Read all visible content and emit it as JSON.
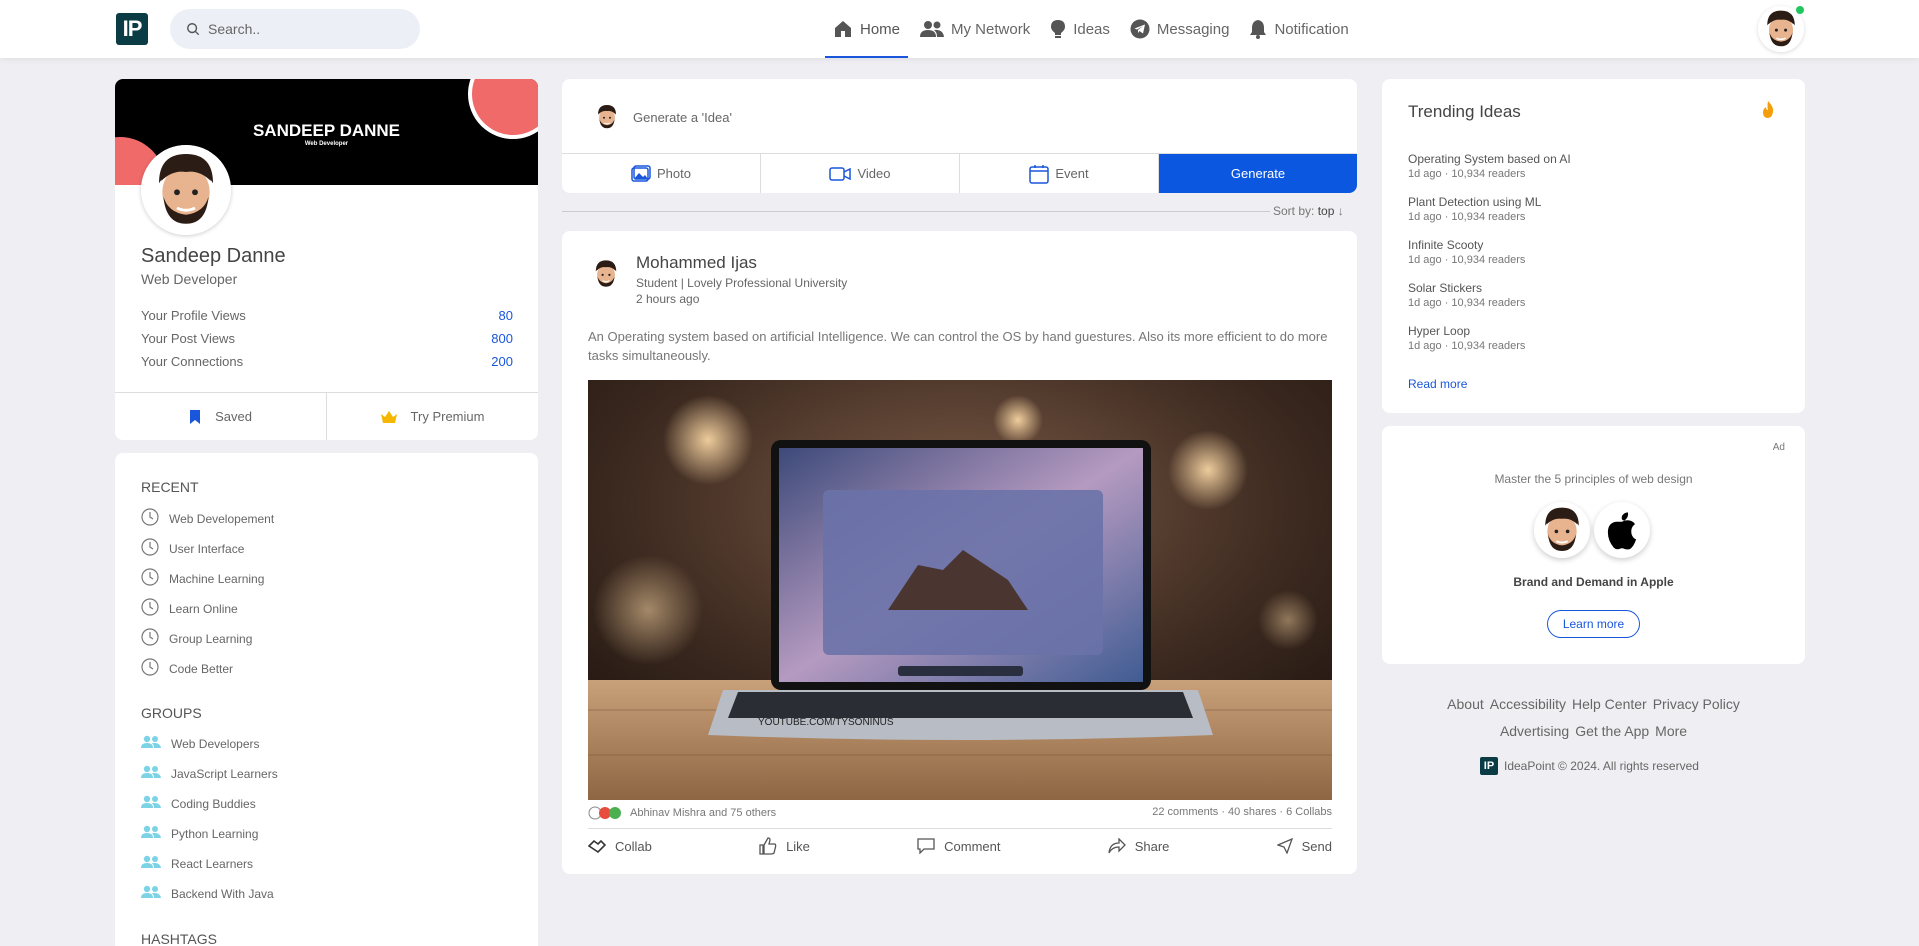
{
  "topbar": {
    "logo": "IP",
    "search_placeholder": "Search..",
    "nav": [
      {
        "label": "Home",
        "icon": "home-icon"
      },
      {
        "label": "My Network",
        "icon": "people-icon"
      },
      {
        "label": "Ideas",
        "icon": "bulb-icon"
      },
      {
        "label": "Messaging",
        "icon": "telegram-icon"
      },
      {
        "label": "Notification",
        "icon": "bell-icon"
      }
    ]
  },
  "profile": {
    "cover_title": "SANDEEP DANNE",
    "cover_subtitle": "Web Developer",
    "name": "Sandeep Danne",
    "role": "Web Developer",
    "stats": [
      {
        "label": "Your Profile Views",
        "value": "80"
      },
      {
        "label": "Your Post Views",
        "value": "800"
      },
      {
        "label": "Your Connections",
        "value": "200"
      }
    ],
    "saved_label": "Saved",
    "premium_label": "Try Premium"
  },
  "sidebar": {
    "recent_title": "RECENT",
    "recent": [
      "Web Developement",
      "User Interface",
      "Machine Learning",
      "Learn Online",
      "Group Learning",
      "Code Better"
    ],
    "groups_title": "GROUPS",
    "groups": [
      "Web Developers",
      "JavaScript Learners",
      "Coding Buddies",
      "Python Learning",
      "React Learners",
      "Backend With Java"
    ],
    "hashtags_title": "HASHTAGS"
  },
  "composer": {
    "prompt": "Generate a 'Idea'",
    "photo_label": "Photo",
    "video_label": "Video",
    "event_label": "Event",
    "generate_label": "Generate"
  },
  "sort": {
    "label": "Sort by:",
    "value": "top"
  },
  "post": {
    "author": "Mohammed Ijas",
    "subtitle": "Student | Lovely Professional University",
    "time": "2 hours ago",
    "text": "An Operating system based on artificial Intelligence. We can control the OS by hand guestures. Also its more efficient to do more tasks simultaneously.",
    "image_watermark": "YOUTUBE.COM/TYSONINUS",
    "reactions": "Abhinav Mishra and 75 others",
    "counts": "22 comments · 40 shares · 6 Collabs",
    "actions": [
      "Collab",
      "Like",
      "Comment",
      "Share",
      "Send"
    ]
  },
  "trending": {
    "title": "Trending Ideas",
    "items": [
      {
        "title": "Operating System based on AI",
        "meta": "1d ago · 10,934 readers"
      },
      {
        "title": "Plant Detection using ML",
        "meta": "1d ago · 10,934 readers"
      },
      {
        "title": "Infinite Scooty",
        "meta": "1d ago · 10,934 readers"
      },
      {
        "title": "Solar Stickers",
        "meta": "1d ago · 10,934 readers"
      },
      {
        "title": "Hyper Loop",
        "meta": "1d ago · 10,934 readers"
      }
    ],
    "read_more": "Read more"
  },
  "ad": {
    "tag": "Ad",
    "headline": "Master the 5 principles of web design",
    "title": "Brand and Demand in Apple",
    "button": "Learn more"
  },
  "footer": {
    "row1": [
      "About",
      "Accessibility",
      "Help Center",
      "Privacy Policy"
    ],
    "row2": [
      "Advertising",
      "Get the App",
      "More"
    ],
    "copyright": "IdeaPoint © 2024. All rights reserved",
    "logo": "IP"
  },
  "colors": {
    "accent": "#1a56db",
    "generate": "#0b57e0",
    "brand": "#0b3c46",
    "cover_circle": "#f06a6a"
  }
}
